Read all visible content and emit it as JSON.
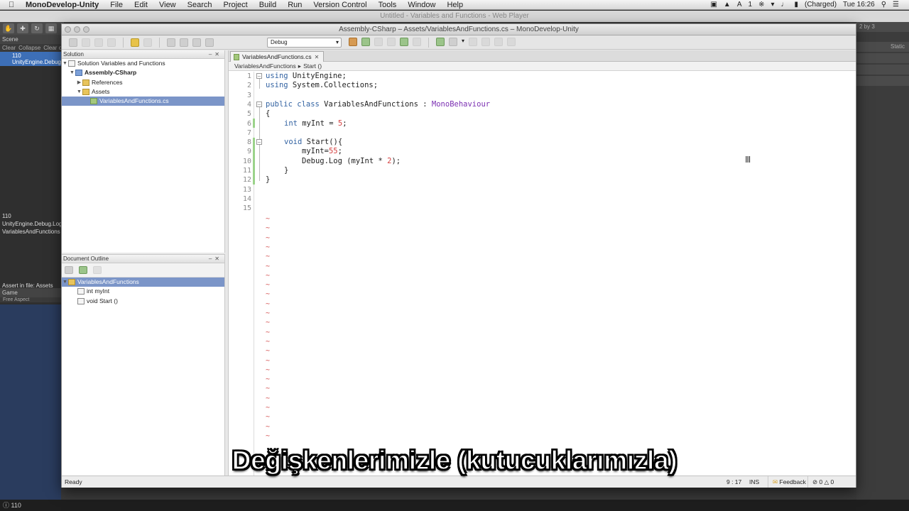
{
  "menubar": {
    "app": "MonoDevelop-Unity",
    "items": [
      "File",
      "Edit",
      "View",
      "Search",
      "Project",
      "Build",
      "Run",
      "Version Control",
      "Tools",
      "Window",
      "Help"
    ],
    "battery": "(Charged)",
    "clock": "Tue 16:26",
    "input_indicator": "1"
  },
  "unity": {
    "title": "Untitled - Variables and Functions - Web Player",
    "scene_tab": "Scene",
    "console_buttons": [
      "Clear",
      "Collapse",
      "Clear on"
    ],
    "console_rows": [
      "110",
      "UnityEngine.Debug"
    ],
    "log_lines": [
      "110",
      "UnityEngine.Debug.Log",
      "VariablesAndFunctions"
    ],
    "assert_text": "Assert in file: Assets",
    "game_tab": "Game",
    "aspect": "Free Aspect",
    "right_labels": [
      "2 by 3",
      "Static"
    ],
    "bottom_status": "110"
  },
  "md": {
    "title": "Assembly-CSharp – Assets/VariablesAndFunctions.cs – MonoDevelop-Unity",
    "config": "Debug",
    "solution_pane": {
      "title": "Solution",
      "items": [
        {
          "label": "Solution Variables and Functions"
        },
        {
          "label": "Assembly-CSharp"
        },
        {
          "label": "References"
        },
        {
          "label": "Assets"
        },
        {
          "label": "VariablesAndFunctions.cs"
        }
      ]
    },
    "outline_pane": {
      "title": "Document Outline",
      "items": [
        {
          "label": "VariablesAndFunctions"
        },
        {
          "label": "int myInt"
        },
        {
          "label": "void Start ()"
        }
      ]
    },
    "editor": {
      "tab": "VariablesAndFunctions.cs",
      "breadcrumb": [
        "VariablesAndFunctions",
        "Start ()"
      ],
      "line_numbers": [
        "1",
        "2",
        "3",
        "4",
        "5",
        "6",
        "7",
        "8",
        "9",
        "10",
        "11",
        "12",
        "13",
        "14",
        "15"
      ],
      "code": {
        "l1_kw": "using",
        "l1_rest": " UnityEngine;",
        "l2_kw": "using",
        "l2_rest": " System.Collections;",
        "l4_kw": "public class",
        "l4_name": " VariablesAndFunctions : ",
        "l4_base": "MonoBehaviour",
        "l5": "{",
        "l6_kw": "int",
        "l6_rest": " myInt = ",
        "l6_num": "5",
        "l6_end": ";",
        "l8_kw": "void",
        "l8_rest": " Start(){",
        "l9_pre": "myInt=",
        "l9_num": "55",
        "l9_end": ";",
        "l10_pre": "Debug.Log (myInt * ",
        "l10_num": "2",
        "l10_end": ");",
        "l11": "}",
        "l12": "}"
      },
      "tilde": "~"
    },
    "status": {
      "ready": "Ready",
      "position": "9 : 17",
      "mode": "INS",
      "feedback": "Feedback",
      "errors": "0",
      "warnings": "0"
    }
  },
  "subtitle": "Değişkenlerimizle (kutucuklarımızla)"
}
